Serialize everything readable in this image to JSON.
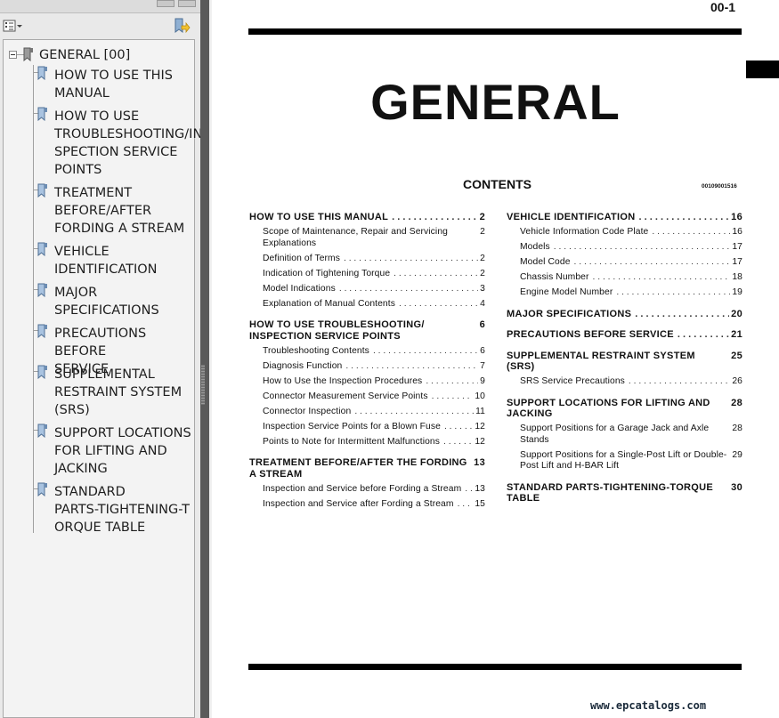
{
  "bookmarks_panel": {
    "options_icon": "list-options-icon",
    "action_icon": "bookmark-action-icon",
    "root": {
      "label": "GENERAL [00]",
      "expanded": true
    },
    "items": [
      {
        "label": "HOW TO USE THIS\nMANUAL"
      },
      {
        "label": "HOW TO USE\nTROUBLESHOOTING/IN\nSPECTION SERVICE\nPOINTS"
      },
      {
        "label": "TREATMENT\nBEFORE/AFTER\nFORDING A STREAM"
      },
      {
        "label": "VEHICLE\nIDENTIFICATION"
      },
      {
        "label": "MAJOR\nSPECIFICATIONS"
      },
      {
        "label": "PRECAUTIONS BEFORE\nSERVICE"
      },
      {
        "label": "SUPPLEMENTAL\nRESTRAINT SYSTEM\n(SRS)"
      },
      {
        "label": "SUPPORT LOCATIONS\nFOR LIFTING AND\nJACKING"
      },
      {
        "label": "STANDARD\nPARTS-TIGHTENING-T\nORQUE TABLE"
      }
    ]
  },
  "page": {
    "page_number": "00-1",
    "title": "GENERAL",
    "contents_heading": "CONTENTS",
    "doc_id": "00109001516",
    "website": "www.epcatalogs.com",
    "columns": [
      [
        {
          "heading": "HOW TO USE THIS MANUAL",
          "page": "2",
          "entries": [
            {
              "text": "Scope of Maintenance, Repair and Servicing Explanations",
              "page": "2"
            },
            {
              "text": "Definition of Terms",
              "page": "2"
            },
            {
              "text": "Indication of Tightening Torque",
              "page": "2"
            },
            {
              "text": "Model Indications",
              "page": "3"
            },
            {
              "text": "Explanation of Manual Contents",
              "page": "4"
            }
          ]
        },
        {
          "heading": "HOW TO USE TROUBLESHOOTING/ INSPECTION SERVICE POINTS",
          "page": "6",
          "entries": [
            {
              "text": "Troubleshooting Contents",
              "page": "6"
            },
            {
              "text": "Diagnosis Function",
              "page": "7"
            },
            {
              "text": "How to Use the Inspection Procedures",
              "page": "9"
            },
            {
              "text": "Connector Measurement Service Points",
              "page": "10"
            },
            {
              "text": "Connector Inspection",
              "page": "11"
            },
            {
              "text": "Inspection Service Points for a Blown Fuse",
              "page": "12"
            },
            {
              "text": "Points to Note for Intermittent Malfunctions",
              "page": "12"
            }
          ]
        },
        {
          "heading": "TREATMENT BEFORE/AFTER THE FORDING A STREAM",
          "page": "13",
          "entries": [
            {
              "text": "Inspection and Service before Fording a Stream",
              "page": "13"
            },
            {
              "text": "Inspection and Service after Fording a Stream",
              "page": "15"
            }
          ]
        }
      ],
      [
        {
          "heading": "VEHICLE IDENTIFICATION",
          "page": "16",
          "entries": [
            {
              "text": "Vehicle Information Code Plate",
              "page": "16"
            },
            {
              "text": "Models",
              "page": "17"
            },
            {
              "text": "Model Code",
              "page": "17"
            },
            {
              "text": "Chassis Number",
              "page": "18"
            },
            {
              "text": "Engine Model Number",
              "page": "19"
            }
          ]
        },
        {
          "heading": "MAJOR SPECIFICATIONS",
          "page": "20",
          "entries": []
        },
        {
          "heading": "PRECAUTIONS BEFORE SERVICE",
          "page": "21",
          "entries": []
        },
        {
          "heading": "SUPPLEMENTAL RESTRAINT SYSTEM (SRS)",
          "page": "25",
          "entries": [
            {
              "text": "SRS Service Precautions",
              "page": "26"
            }
          ]
        },
        {
          "heading": "SUPPORT LOCATIONS FOR LIFTING AND JACKING",
          "page": "28",
          "entries": [
            {
              "text": "Support Positions for a Garage Jack and Axle Stands",
              "page": "28"
            },
            {
              "text": "Support Positions for a Single-Post Lift or Double-Post Lift and H-BAR Lift",
              "page": "29"
            }
          ]
        },
        {
          "heading": "STANDARD PARTS-TIGHTENING-TORQUE TABLE",
          "page": "30",
          "entries": []
        }
      ]
    ]
  }
}
